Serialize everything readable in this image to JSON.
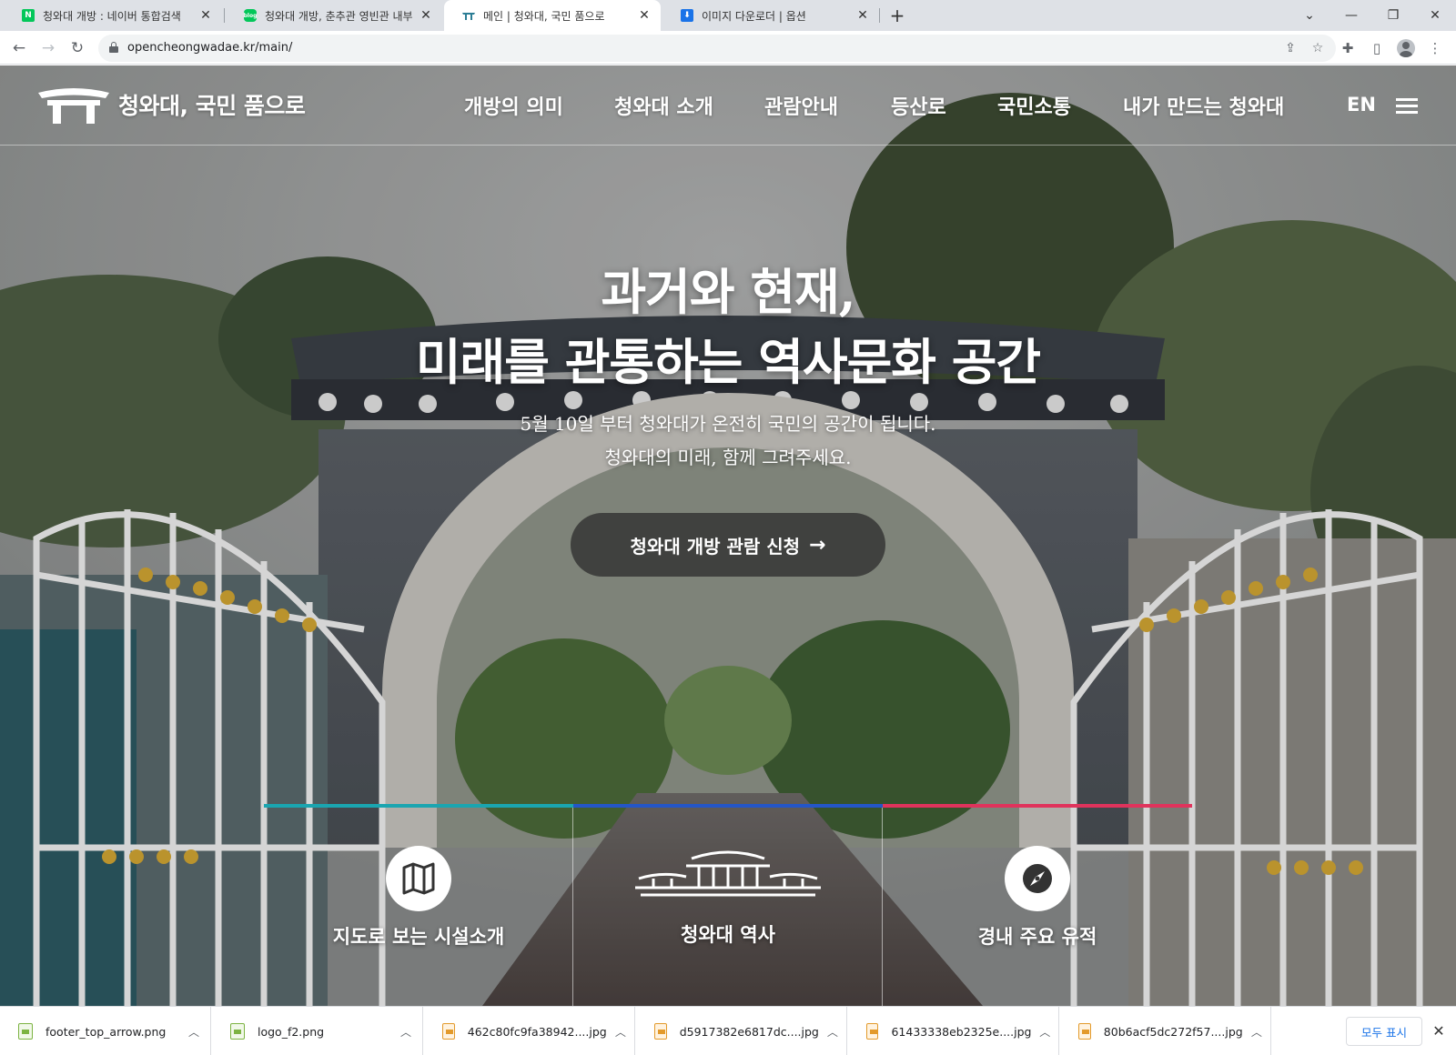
{
  "browser": {
    "tabs": [
      {
        "title": "청와대 개방 : 네이버 통합검색",
        "favicon": "naver-icon",
        "color": "#03c75a"
      },
      {
        "title": "청와대 개방, 춘추관 영빈관 내부",
        "favicon": "naver-blog-icon",
        "color": "#03c75a"
      },
      {
        "title": "메인 | 청와대, 국민 품으로",
        "favicon": "cheongwadae-icon",
        "color": "#2b7d95"
      },
      {
        "title": "이미지 다운로더 | 옵션",
        "favicon": "download-icon",
        "color": "#1a73e8"
      }
    ],
    "url": "opencheongwadae.kr/main/"
  },
  "site": {
    "logo_text": "청와대, 국민 품으로",
    "nav": [
      "개방의 의미",
      "청와대 소개",
      "관람안내",
      "등산로",
      "국민소통",
      "내가 만드는 청와대"
    ],
    "lang": "EN",
    "hero": {
      "title_line1": "과거와 현재,",
      "title_line2": "미래를 관통하는 역사문화 공간",
      "sub_line1": "5월 10일 부터 청와대가 온전히 국민의 공간이 됩니다.",
      "sub_line2": "청와대의 미래, 함께 그려주세요.",
      "cta": "청와대 개방 관람 신청"
    },
    "quick_links": [
      {
        "label": "지도로 보는 시설소개",
        "icon": "map-icon",
        "color": "#1aa5b0"
      },
      {
        "label": "청와대 역사",
        "icon": "palace-icon",
        "color": "#2456c8"
      },
      {
        "label": "경내 주요 유적",
        "icon": "compass-icon",
        "color": "#e0335c"
      }
    ]
  },
  "downloads": {
    "items": [
      {
        "name": "footer_top_arrow.png",
        "type": "png"
      },
      {
        "name": "logo_f2.png",
        "type": "png"
      },
      {
        "name": "462c80fc9fa38942....jpg",
        "type": "jpg"
      },
      {
        "name": "d5917382e6817dc....jpg",
        "type": "jpg"
      },
      {
        "name": "61433338eb2325e....jpg",
        "type": "jpg"
      },
      {
        "name": "80b6acf5dc272f57....jpg",
        "type": "jpg"
      }
    ],
    "show_all": "모두 표시"
  }
}
